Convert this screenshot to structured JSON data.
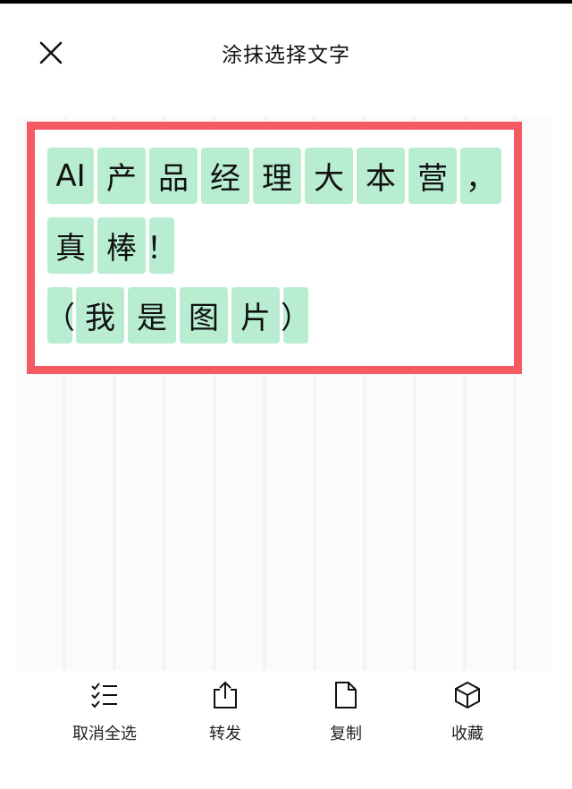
{
  "header": {
    "title": "涂抹选择文字",
    "close_icon": "close-icon"
  },
  "image": {
    "lines": [
      [
        "AI",
        "产",
        "品",
        "经",
        "理",
        "大",
        "本",
        "营",
        "，"
      ],
      [
        "真",
        "棒",
        "！"
      ],
      [
        "（",
        "我",
        "是",
        "图",
        "片",
        "）"
      ]
    ],
    "highlight_color": "#b8edd1",
    "frame_color": "#f55a62"
  },
  "toolbar": {
    "items": [
      {
        "label": "取消全选",
        "icon": "checklist-icon"
      },
      {
        "label": "转发",
        "icon": "share-icon"
      },
      {
        "label": "复制",
        "icon": "document-icon"
      },
      {
        "label": "收藏",
        "icon": "box-icon"
      }
    ]
  }
}
